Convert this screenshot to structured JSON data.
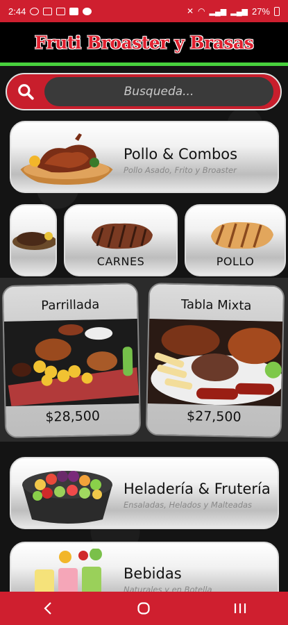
{
  "status_bar": {
    "time": "2:44",
    "battery": "27%"
  },
  "app": {
    "title": "Fruti Broaster y Brasas"
  },
  "search": {
    "placeholder": "Busqueda..."
  },
  "categories": [
    {
      "title": "Pollo & Combos",
      "subtitle": "Pollo Asado, Frito y Broaster",
      "icon": "roast-chicken-image"
    },
    {
      "title": "Heladería & Frutería",
      "subtitle": "Ensaladas, Helados y Malteadas",
      "icon": "fruit-platter-image"
    },
    {
      "title": "Bebidas",
      "subtitle": "Naturales y en Botella",
      "icon": "drinks-image"
    }
  ],
  "small_categories": [
    {
      "label": "",
      "icon": "grilled-meat-image"
    },
    {
      "label": "CARNES",
      "icon": "steak-image"
    },
    {
      "label": "POLLO",
      "icon": "chicken-breast-image"
    }
  ],
  "promos": [
    {
      "title": "Parrillada",
      "price": "$28,500",
      "icon": "parrillada-image"
    },
    {
      "title": "Tabla Mixta",
      "price": "$27,500",
      "icon": "tabla-mixta-image"
    }
  ],
  "colors": {
    "brand_red": "#cf1f2f",
    "accent_green": "#48d13d"
  },
  "nav": {
    "back": "<",
    "home": "O",
    "recents": "|||"
  }
}
